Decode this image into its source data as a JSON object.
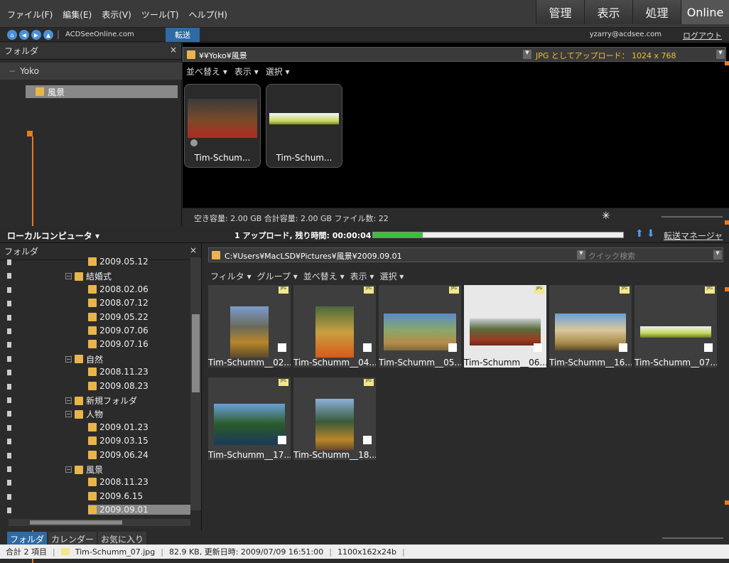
{
  "menus": [
    "ファイル(F)",
    "編集(E)",
    "表示(V)",
    "ツール(T)",
    "ヘルプ(H)"
  ],
  "mode_tabs": [
    "管理",
    "表示",
    "処理",
    "Online"
  ],
  "site": "ACDSeeOnline.com",
  "transfer_label": "転送",
  "user": "yzarry@acdsee.com",
  "logout": "ログアウト",
  "online": {
    "folder_label": "フォルダ",
    "close": "×",
    "root": "Yoko",
    "selected_folder": "風景",
    "path": "¥¥Yoko¥風景",
    "upload_as": "JPG としてアップロード： 1024 x 768",
    "sort_menu": [
      "並べ替え",
      "表示",
      "選択"
    ],
    "thumbs": [
      "Tim-Schum...",
      "Tim-Schum..."
    ],
    "status": "空き容量: 2.00 GB 合計容量: 2.00 GB ファイル数: 22"
  },
  "local": {
    "title": "ローカルコンピュータ",
    "upload_status": "1 アップロード, 残り時間: 00:00:04",
    "progress": 0.2,
    "transfer_manager": "転送マネージャ",
    "folder_label": "フォルダ",
    "close": "×",
    "path": "C:¥Users¥MacLSD¥Pictures¥風景¥2009.09.01",
    "search_placeholder": "クイック検索",
    "filter_menu": [
      "フィルタ",
      "グループ",
      "並べ替え",
      "表示",
      "選択"
    ],
    "tree": [
      {
        "label": "2009.05.12",
        "level": 2
      },
      {
        "label": "結婚式",
        "level": 1
      },
      {
        "label": "2008.02.06",
        "level": 2
      },
      {
        "label": "2008.07.12",
        "level": 2
      },
      {
        "label": "2009.05.22",
        "level": 2
      },
      {
        "label": "2009.07.06",
        "level": 2
      },
      {
        "label": "2009.07.16",
        "level": 2
      },
      {
        "label": "自然",
        "level": 1
      },
      {
        "label": "2008.11.23",
        "level": 2
      },
      {
        "label": "2009.08.23",
        "level": 2
      },
      {
        "label": "新規フォルダ",
        "level": 1
      },
      {
        "label": "人物",
        "level": 1
      },
      {
        "label": "2009.01.23",
        "level": 2
      },
      {
        "label": "2009.03.15",
        "level": 2
      },
      {
        "label": "2009.06.24",
        "level": 2
      },
      {
        "label": "風景",
        "level": 1
      },
      {
        "label": "2008.11.23",
        "level": 2
      },
      {
        "label": "2009.6.15",
        "level": 2
      },
      {
        "label": "2009.09.01",
        "level": 2
      }
    ],
    "tabs": [
      "フォルダ",
      "カレンダー",
      "お気に入り"
    ],
    "files": [
      "Tim-Schumm__02...",
      "Tim-Schumm__04...",
      "Tim-Schumm__05...",
      "Tim-Schumm__06...",
      "Tim-Schumm__16...",
      "Tim-Schumm__07...",
      "Tim-Schumm__17...",
      "Tim-Schumm__18..."
    ],
    "badge": "JPG"
  },
  "statusbar": {
    "total": "合計 2 項目",
    "file": "Tim-Schumm_07.jpg",
    "info": "82.9 KB, 更新日時: 2009/07/09 16:51:00",
    "dims": "1100x162x24b"
  }
}
